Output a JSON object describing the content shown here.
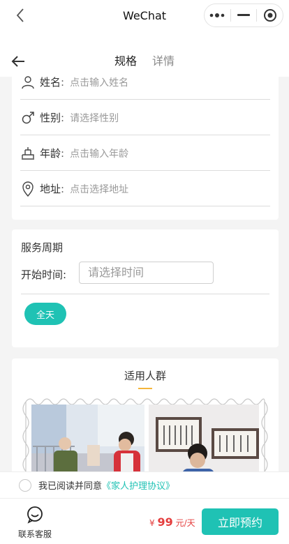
{
  "titlebar": {
    "title": "WeChat"
  },
  "tabs": [
    {
      "label": "规格"
    },
    {
      "label": "详情"
    }
  ],
  "form": {
    "colon": ":",
    "name": {
      "label": "姓名",
      "placeholder": "点击输入姓名"
    },
    "gender": {
      "label": "性别",
      "placeholder": "请选择性别"
    },
    "age": {
      "label": "年龄",
      "placeholder": "点击输入年龄"
    },
    "address": {
      "label": "地址",
      "placeholder": "点击选择地址"
    }
  },
  "period": {
    "title": "服务周期",
    "start_label": "开始时间:",
    "start_placeholder": "请选择时间",
    "allday": "全天"
  },
  "group": {
    "title": "适用人群"
  },
  "agreement": {
    "prefix": "我已阅读并同意",
    "link": "《家人护理协议》"
  },
  "bottom": {
    "service_label": "联系客服",
    "currency": "¥",
    "price": "99",
    "unit": "元/天",
    "book": "立即预约"
  },
  "colors": {
    "accent": "#1fc2b4",
    "price": "#e43d3d",
    "underline": "#f5b53a"
  },
  "icons": [
    "back-chevron-icon",
    "more-dots-icon",
    "minimize-icon",
    "close-target-icon",
    "back-arrow-icon",
    "person-icon",
    "male-icon",
    "age-icon",
    "location-pin-icon",
    "chat-bubble-icon"
  ]
}
